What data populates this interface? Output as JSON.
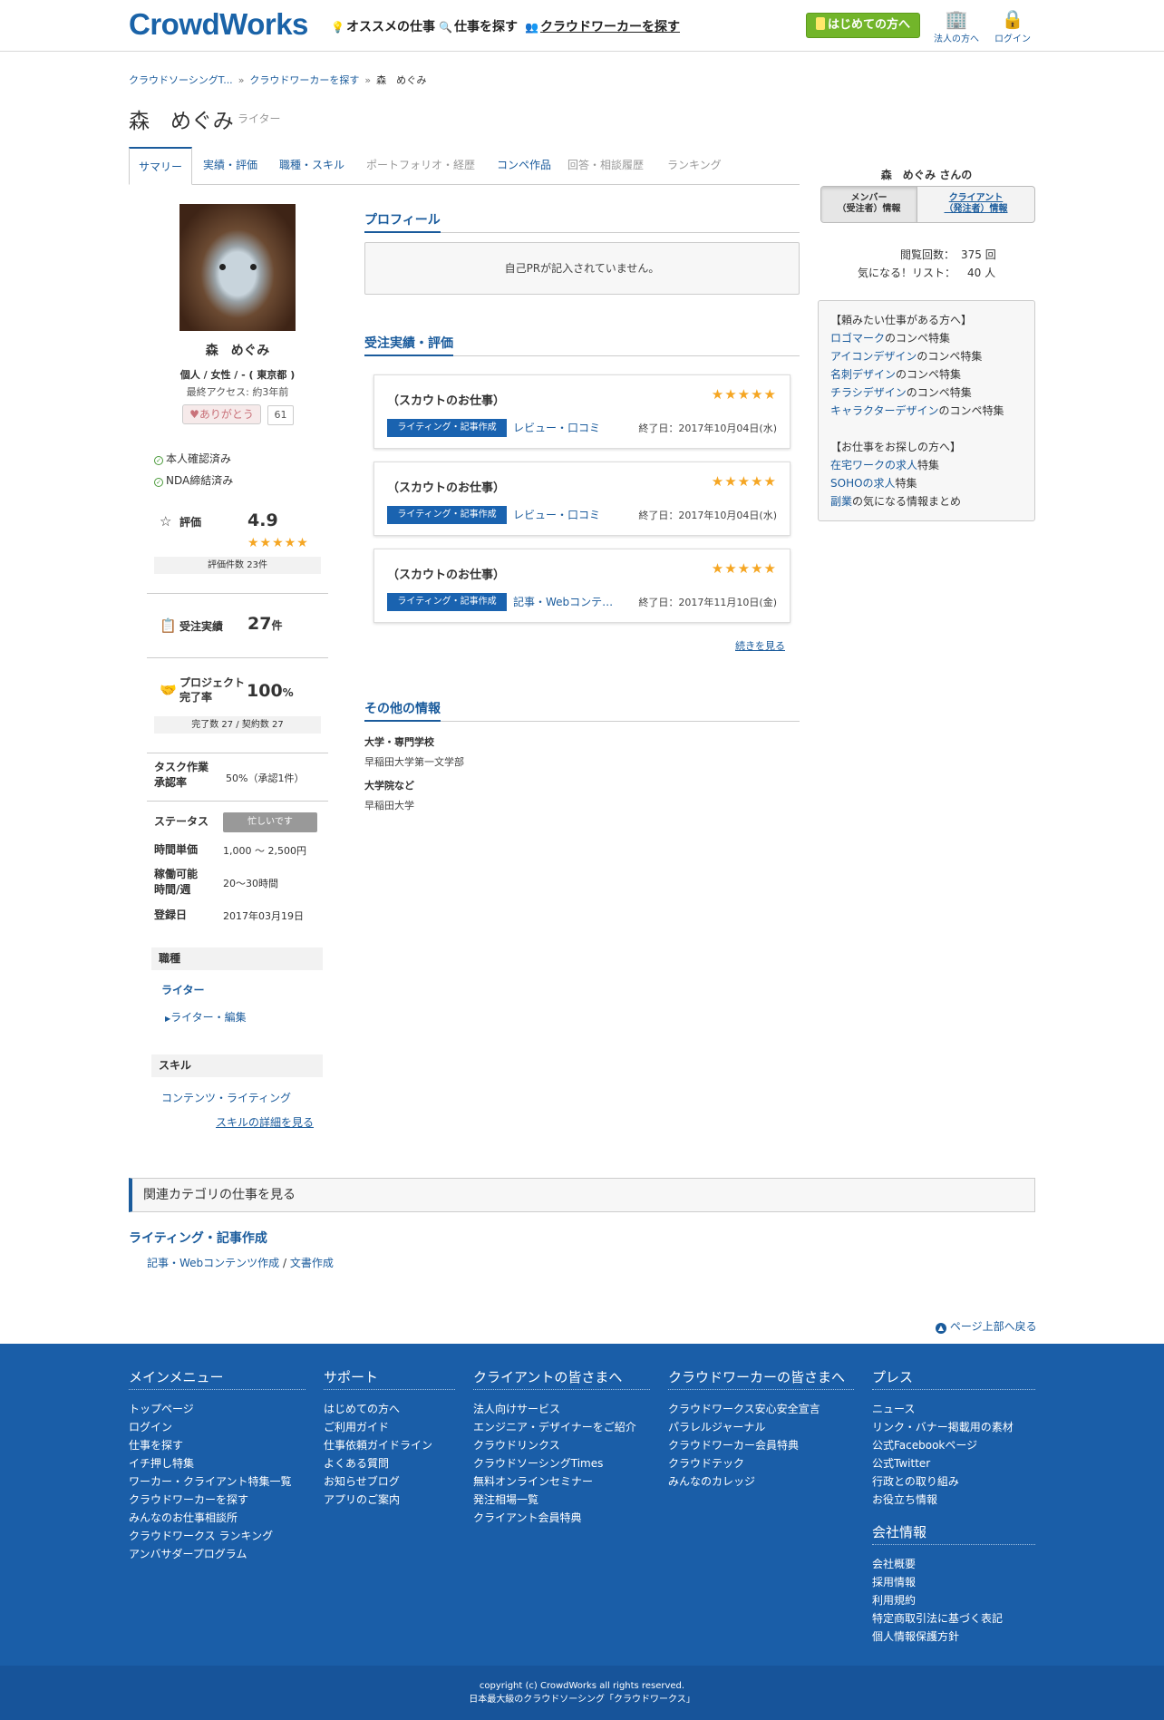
{
  "header": {
    "logo": "CrowdWorks",
    "nav": [
      "オススメの仕事",
      "仕事を探す",
      "クラウドワーカーを探す"
    ],
    "first_button": "はじめての方へ",
    "corporate": "法人の方へ",
    "login": "ログイン"
  },
  "breadcrumb": [
    "クラウドソーシングT...",
    "クラウドワーカーを探す",
    "森　めぐみ"
  ],
  "profile_title": {
    "name": "森　めぐみ",
    "occupation": "ライター"
  },
  "tabs": [
    {
      "label": "サマリー",
      "state": "active"
    },
    {
      "label": "実績・評価",
      "state": "link"
    },
    {
      "label": "職種・スキル",
      "state": "link"
    },
    {
      "label": "ポートフォリオ・経歴",
      "state": "disabled"
    },
    {
      "label": "コンペ作品",
      "state": "link"
    },
    {
      "label": "回答・相談履歴",
      "state": "disabled"
    },
    {
      "label": "ランキング",
      "state": "disabled"
    }
  ],
  "left": {
    "name": "森　めぐみ",
    "meta": "個人 / 女性 / - ( 東京都 )",
    "last_access": "最終アクセス: 約3年前",
    "thanks_label": "ありがとう",
    "thanks_count": "61",
    "verifications": [
      "本人確認済み",
      "NDA締結済み"
    ],
    "rating": {
      "label": "評価",
      "value": "4.9",
      "stars": 5,
      "count_text": "評価件数 23件"
    },
    "orders": {
      "label": "受注実績",
      "value": "27",
      "unit": "件"
    },
    "completion": {
      "label_1": "プロジェクト",
      "label_2": "完了率",
      "value": "100",
      "unit": "%",
      "sub": "完了数 27 / 契約数 27"
    },
    "task": {
      "label_1": "タスク作業",
      "label_2": "承認率",
      "value": "50%（承認1件）"
    },
    "status": {
      "label": "ステータス",
      "value": "忙しいです"
    },
    "hourly": {
      "label": "時間単価",
      "value": "1,000 ～ 2,500円"
    },
    "hours": {
      "label_1": "稼働可能",
      "label_2": "時間/週",
      "value": "20〜30時間"
    },
    "registered": {
      "label": "登録日",
      "value": "2017年03月19日"
    },
    "occupation_head": "職種",
    "occupation_main": "ライター",
    "occupation_sub": "ライター・編集",
    "skill_head": "スキル",
    "skill": "コンテンツ・ライティング",
    "skill_more": "スキルの詳細を見る"
  },
  "main": {
    "profile_heading": "プロフィール",
    "pr_text": "自己PRが記入されていません。",
    "results_heading": "受注実績・評価",
    "jobs": [
      {
        "title": "（スカウトのお仕事）",
        "category": "ライティング・記事作成",
        "sub": "レビュー・口コミ",
        "end": "終了日：2017年10月04日(水)"
      },
      {
        "title": "（スカウトのお仕事）",
        "category": "ライティング・記事作成",
        "sub": "レビュー・口コミ",
        "end": "終了日：2017年10月04日(水)"
      },
      {
        "title": "（スカウトのお仕事）",
        "category": "ライティング・記事作成",
        "sub": "記事・Webコンテンツ作成",
        "end": "終了日：2017年11月10日(金)"
      }
    ],
    "job_stars": 5,
    "more": "続きを見る",
    "other_heading": "その他の情報",
    "other": [
      {
        "label": "大学・専門学校",
        "value": "早稲田大学第一文学部"
      },
      {
        "label": "大学院など",
        "value": "早稲田大学"
      }
    ]
  },
  "right": {
    "heading": "森　めぐみ さんの",
    "tab_member_1": "メンバー",
    "tab_member_2": "（受注者）情報",
    "tab_client_1": "クライアント",
    "tab_client_2": "（発注者）情報",
    "views_label": "閲覧回数：",
    "views_value": "375 回",
    "fav_label": "気になる！リスト：",
    "fav_value": "40 人",
    "ad_head_1": "【頼みたい仕事がある方へ】",
    "ad_links_1": [
      {
        "link": "ロゴマーク",
        "rest": "のコンペ特集"
      },
      {
        "link": "アイコンデザイン",
        "rest": "のコンペ特集"
      },
      {
        "link": "名刺デザイン",
        "rest": "のコンペ特集"
      },
      {
        "link": "チラシデザイン",
        "rest": "のコンペ特集"
      },
      {
        "link": "キャラクターデザイン",
        "rest": "のコンペ特集"
      }
    ],
    "ad_head_2": "【お仕事をお探しの方へ】",
    "ad_links_2": [
      {
        "link": "在宅ワークの求人",
        "rest": "特集"
      },
      {
        "link": "SOHOの求人",
        "rest": "特集"
      },
      {
        "link": "副業",
        "rest": "の気になる情報まとめ"
      }
    ]
  },
  "related": {
    "bar": "関連カテゴリの仕事を見る",
    "category": "ライティング・記事作成",
    "link_1": "記事・Webコンテンツ作成",
    "link_sep": " / ",
    "link_2": "文書作成"
  },
  "to_top": "ページ上部へ戻る",
  "footer": {
    "cols": [
      {
        "title": "メインメニュー",
        "items": [
          "トップページ",
          "ログイン",
          "仕事を探す",
          "イチ押し特集",
          "ワーカー・クライアント特集一覧",
          "クラウドワーカーを探す",
          "みんなのお仕事相談所",
          "クラウドワークス ランキング",
          "アンバサダープログラム"
        ]
      },
      {
        "title": "サポート",
        "items": [
          "はじめての方へ",
          "ご利用ガイド",
          "仕事依頼ガイドライン",
          "よくある質問",
          "お知らせブログ",
          "アプリのご案内"
        ]
      },
      {
        "title": "クライアントの皆さまへ",
        "items": [
          "法人向けサービス",
          "エンジニア・デザイナーをご紹介",
          "クラウドリンクス",
          "クラウドソーシングTimes",
          "無料オンラインセミナー",
          "発注相場一覧",
          "クライアント会員特典"
        ]
      },
      {
        "title": "クラウドワーカーの皆さまへ",
        "items": [
          "クラウドワークス安心安全宣言",
          "パラレルジャーナル",
          "クラウドワーカー会員特典",
          "クラウドテック",
          "みんなのカレッジ"
        ]
      },
      {
        "title": "プレス",
        "items": [
          "ニュース",
          "リンク・バナー掲載用の素材",
          "公式Facebookページ",
          "公式Twitter",
          "行政との取り組み",
          "お役立ち情報"
        ]
      },
      {
        "title": "会社情報",
        "items": [
          "会社概要",
          "採用情報",
          "利用規約",
          "特定商取引法に基づく表記",
          "個人情報保護方針"
        ]
      }
    ],
    "copyright": "copyright (c) CrowdWorks all rights reserved.",
    "tagline": "日本最大級のクラウドソーシング「クラウドワークス」"
  },
  "colors": {
    "brand": "#1a5ea8",
    "link": "#1a5b9c",
    "cta": "#72b52a",
    "star": "#f5a623"
  }
}
